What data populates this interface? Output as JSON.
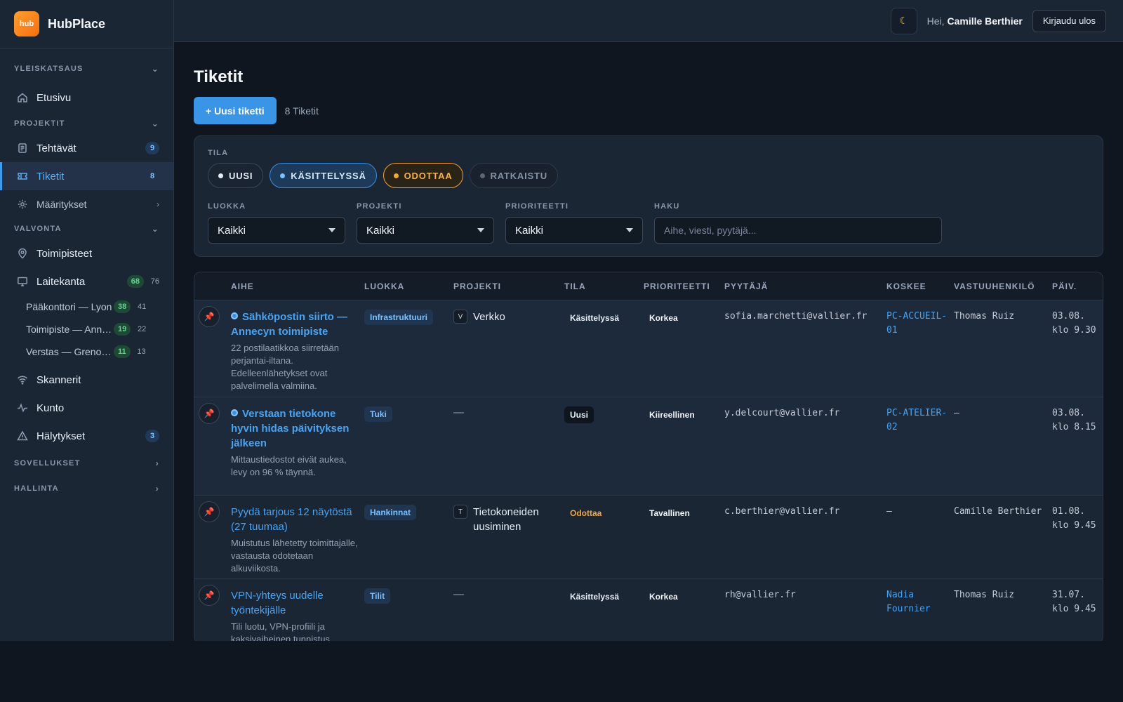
{
  "brand": {
    "logo_text": "hub",
    "name": "HubPlace"
  },
  "topbar": {
    "theme_icon": "☾",
    "greeting_prefix": "Hei,",
    "user_name": "Camille Berthier",
    "logout_label": "Kirjaudu ulos"
  },
  "sidebar": {
    "sections": {
      "overview": "YLEISKATSAUS",
      "projects": "PROJEKTIT",
      "monitoring": "VALVONTA",
      "apps": "SOVELLUKSET",
      "admin": "HALLINTA"
    },
    "items": {
      "home": {
        "label": "Etusivu"
      },
      "tasks": {
        "label": "Tehtävät",
        "badge": "9"
      },
      "tickets": {
        "label": "Tiketit",
        "badge": "8"
      },
      "settings": {
        "label": "Määritykset"
      },
      "sites": {
        "label": "Toimipisteet"
      },
      "devices": {
        "label": "Laitekanta",
        "badge": "68",
        "count": "76"
      },
      "scanners": {
        "label": "Skannerit"
      },
      "health": {
        "label": "Kunto"
      },
      "alerts": {
        "label": "Hälytykset",
        "badge": "3"
      }
    },
    "device_sites": [
      {
        "label": "Pääkonttori — Lyon",
        "badge": "38",
        "count": "41"
      },
      {
        "label": "Toimipiste — Annecy",
        "badge": "19",
        "count": "22"
      },
      {
        "label": "Verstas — Grenoble",
        "badge": "11",
        "count": "13"
      }
    ]
  },
  "page": {
    "title": "Tiketit",
    "new_button": "+ Uusi tiketti",
    "total": "8 Tiketit"
  },
  "filters": {
    "status_label": "TILA",
    "chips": [
      "UUSI",
      "KÄSITTELYSSÄ",
      "ODOTTAA",
      "RATKAISTU"
    ],
    "category_label": "LUOKKA",
    "category_value": "Kaikki",
    "project_label": "PROJEKTI",
    "project_value": "Kaikki",
    "priority_label": "PRIORITEETTI",
    "priority_value": "Kaikki",
    "search_label": "HAKU",
    "search_placeholder": "Aihe, viesti, pyytäjä..."
  },
  "table": {
    "headers": [
      "AIHE",
      "LUOKKA",
      "PROJEKTI",
      "TILA",
      "PRIORITEETTI",
      "PYYTÄJÄ",
      "KOSKEE",
      "VASTUUHENKILÖ",
      "PÄIV."
    ],
    "rows": [
      {
        "subject": "Sähköpostin siirto — Annecyn toimipiste",
        "excerpt": "22 postilaatikkoa siirretään perjantai-iltana. Edelleenlähetykset ovat palvelimella valmiina.",
        "category": "Infrastruktuuri",
        "project_mark": "V",
        "project": "Verkko",
        "status": "Käsittelyssä",
        "priority": "Korkea",
        "requester": "sofia.marchetti@vallier.fr",
        "concerns": "PC-ACCUEIL-01",
        "assignee": "Thomas Ruiz",
        "date": "03.08. klo 9.30"
      },
      {
        "subject": "Verstaan tietokone hyvin hidas päivityksen jälkeen",
        "excerpt": "Mittaustiedostot eivät aukea, levy on 96 % täynnä.",
        "category": "Tuki",
        "project_mark": "",
        "project": "—",
        "status": "Uusi",
        "priority": "Kiireellinen",
        "requester": "y.delcourt@vallier.fr",
        "concerns": "PC-ATELIER-02",
        "assignee": "—",
        "date": "03.08. klo 8.15"
      },
      {
        "subject": "Pyydä tarjous 12 näytöstä (27 tuumaa)",
        "excerpt": "Muistutus lähetetty toimittajalle, vastausta odotetaan alkuviikosta.",
        "category": "Hankinnat",
        "project_mark": "T",
        "project": "Tietokoneiden uusiminen",
        "status": "Odottaa",
        "priority": "Tavallinen",
        "requester": "c.berthier@vallier.fr",
        "concerns": "—",
        "assignee": "Camille Berthier",
        "date": "01.08. klo 9.45"
      },
      {
        "subject": "VPN-yhteys uudelle työntekijälle",
        "excerpt": "Tili luotu, VPN-profiili ja kaksivaiheinen tunnistus",
        "category": "Tilit",
        "project_mark": "",
        "project": "—",
        "status": "Käsittelyssä",
        "priority": "Korkea",
        "requester": "rh@vallier.fr",
        "concerns": "Nadia Fournier",
        "assignee": "Thomas Ruiz",
        "date": "31.07. klo 9.45"
      }
    ]
  }
}
